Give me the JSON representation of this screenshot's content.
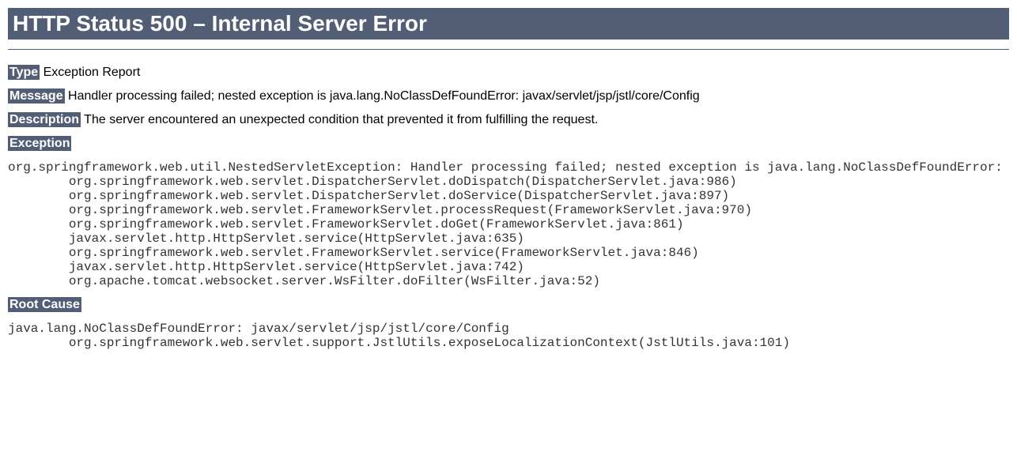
{
  "page": {
    "title": "HTTP Status 500 – Internal Server Error",
    "type_label": "Type",
    "type_value": "Exception Report",
    "message_label": "Message",
    "message_value": "Handler processing failed; nested exception is java.lang.NoClassDefFoundError: javax/servlet/jsp/jstl/core/Config",
    "description_label": "Description",
    "description_value": "The server encountered an unexpected condition that prevented it from fulfilling the request.",
    "exception_label": "Exception",
    "exception_trace": "org.springframework.web.util.NestedServletException: Handler processing failed; nested exception is java.lang.NoClassDefFoundError:\n\torg.springframework.web.servlet.DispatcherServlet.doDispatch(DispatcherServlet.java:986)\n\torg.springframework.web.servlet.DispatcherServlet.doService(DispatcherServlet.java:897)\n\torg.springframework.web.servlet.FrameworkServlet.processRequest(FrameworkServlet.java:970)\n\torg.springframework.web.servlet.FrameworkServlet.doGet(FrameworkServlet.java:861)\n\tjavax.servlet.http.HttpServlet.service(HttpServlet.java:635)\n\torg.springframework.web.servlet.FrameworkServlet.service(FrameworkServlet.java:846)\n\tjavax.servlet.http.HttpServlet.service(HttpServlet.java:742)\n\torg.apache.tomcat.websocket.server.WsFilter.doFilter(WsFilter.java:52)",
    "root_cause_label": "Root Cause",
    "root_cause_trace": "java.lang.NoClassDefFoundError: javax/servlet/jsp/jstl/core/Config\n\torg.springframework.web.servlet.support.JstlUtils.exposeLocalizationContext(JstlUtils.java:101)"
  }
}
